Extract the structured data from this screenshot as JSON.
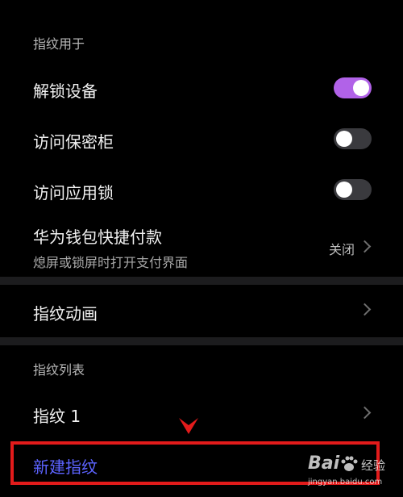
{
  "fingerprint_use_section": {
    "header": "指纹用于",
    "items": [
      {
        "label": "解锁设备",
        "toggle_on": true
      },
      {
        "label": "访问保密柜",
        "toggle_on": false
      },
      {
        "label": "访问应用锁",
        "toggle_on": false
      }
    ],
    "wallet": {
      "label": "华为钱包快捷付款",
      "sublabel": "熄屏或锁屏时打开支付界面",
      "value": "关闭"
    }
  },
  "animation": {
    "label": "指纹动画"
  },
  "fingerprint_list": {
    "header": "指纹列表",
    "items": [
      {
        "label": "指纹 1"
      }
    ],
    "new_label": "新建指纹"
  },
  "watermark": {
    "brand": "Bai",
    "brand_cn": "经验",
    "url": "jingyan.baidu.com"
  },
  "colors": {
    "toggle_on": "#b162e8",
    "link": "#5c63ff",
    "highlight": "#e21b1b"
  }
}
